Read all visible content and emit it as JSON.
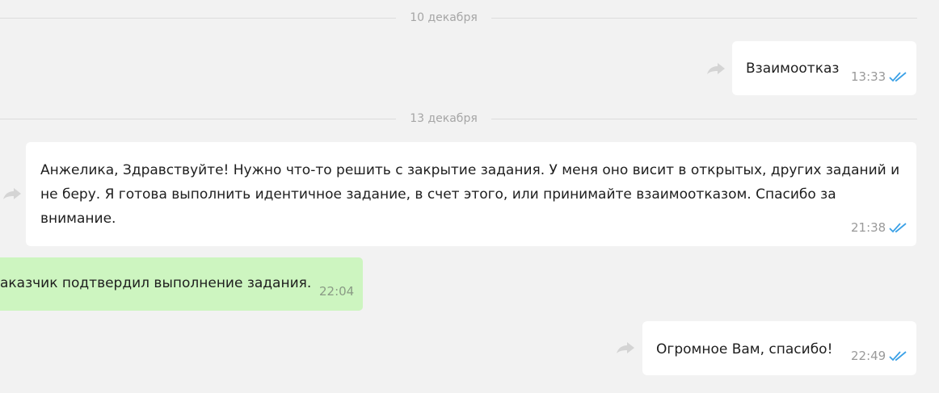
{
  "dates": [
    "10 декабря",
    "13 декабря"
  ],
  "messages": [
    {
      "text": "Взаимоотказ",
      "time": "13:33"
    },
    {
      "lines": [
        "Анжелика, Здравствуйте! Нужно что-то решить с закрытие задания. У меня оно висит в открытых, других заданий и",
        "не беру. Я готова выполнить идентичное задание, в счет этого, или принимайте взаимоотказом.  Спасибо за",
        "внимание."
      ],
      "time": "21:38"
    },
    {
      "text": "Огромное Вам, спасибо!",
      "time": "22:49"
    }
  ],
  "system_message": {
    "text": "аказчик подтвердил выполнение задания.",
    "time": "22:04"
  },
  "colors": {
    "background": "#f2f2f2",
    "bubble": "#ffffff",
    "system_bubble": "#cdf5c0",
    "read_ticks": "#3aa0e6",
    "forward_icon": "#d4d4d4"
  },
  "icons": {
    "forward": "forward-arrow-icon",
    "read_status": "double-check-icon"
  }
}
